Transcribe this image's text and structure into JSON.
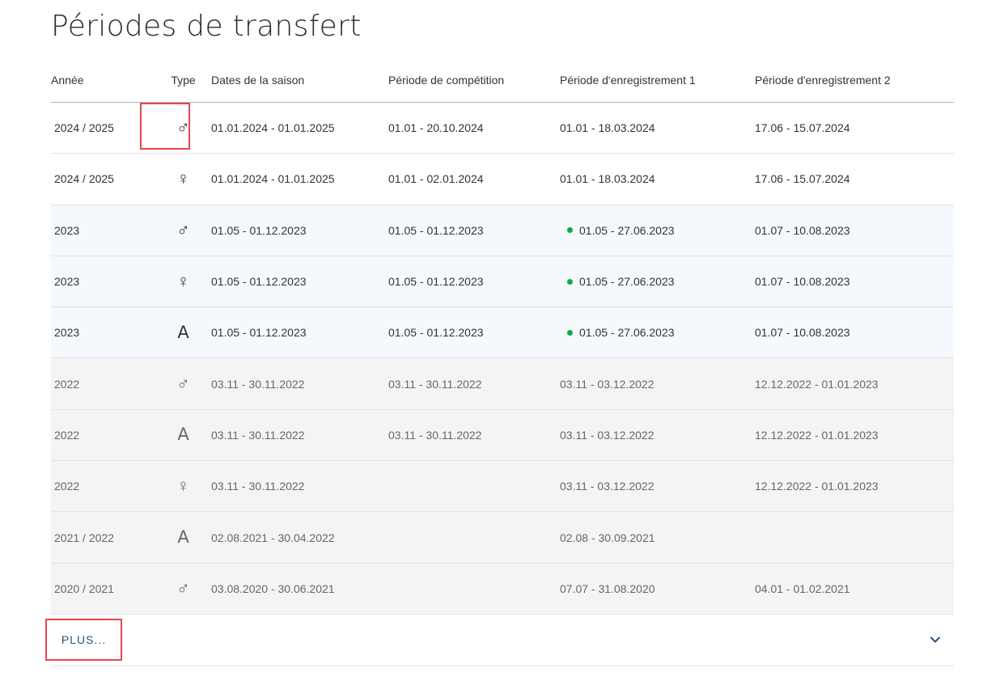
{
  "title": "Périodes de transfert",
  "columns": {
    "year": "Année",
    "type": "Type",
    "season": "Dates de la saison",
    "competition": "Période de compétition",
    "reg1": "Période d'enregistrement 1",
    "reg2": "Période d'enregistrement 2"
  },
  "rows": [
    {
      "year": "2024 / 2025",
      "type": "♂",
      "season": "01.01.2024 - 01.01.2025",
      "competition": "01.01 - 20.10.2024",
      "reg1": "01.01 - 18.03.2024",
      "reg2": "17.06 - 15.07.2024"
    },
    {
      "year": "2024 / 2025",
      "type": "♀",
      "season": "01.01.2024 - 01.01.2025",
      "competition": "01.01 - 02.01.2024",
      "reg1": "01.01 - 18.03.2024",
      "reg2": "17.06 - 15.07.2024"
    },
    {
      "year": "2023",
      "type": "♂",
      "season": "01.05 - 01.12.2023",
      "competition": "01.05 - 01.12.2023",
      "reg1": "01.05 - 27.06.2023",
      "reg2": "01.07 - 10.08.2023"
    },
    {
      "year": "2023",
      "type": "♀",
      "season": "01.05 - 01.12.2023",
      "competition": "01.05 - 01.12.2023",
      "reg1": "01.05 - 27.06.2023",
      "reg2": "01.07 - 10.08.2023"
    },
    {
      "year": "2023",
      "type": "A",
      "season": "01.05 - 01.12.2023",
      "competition": "01.05 - 01.12.2023",
      "reg1": "01.05 - 27.06.2023",
      "reg2": "01.07 - 10.08.2023"
    },
    {
      "year": "2022",
      "type": "♂",
      "season": "03.11 - 30.11.2022",
      "competition": "03.11 - 30.11.2022",
      "reg1": "03.11 - 03.12.2022",
      "reg2": "12.12.2022 - 01.01.2023"
    },
    {
      "year": "2022",
      "type": "A",
      "season": "03.11 - 30.11.2022",
      "competition": "03.11 - 30.11.2022",
      "reg1": "03.11 - 03.12.2022",
      "reg2": "12.12.2022 - 01.01.2023"
    },
    {
      "year": "2022",
      "type": "♀",
      "season": "03.11 - 30.11.2022",
      "competition": "",
      "reg1": "03.11 - 03.12.2022",
      "reg2": "12.12.2022 - 01.01.2023"
    },
    {
      "year": "2021 / 2022",
      "type": "A",
      "season": "02.08.2021 - 30.04.2022",
      "competition": "",
      "reg1": "02.08 - 30.09.2021",
      "reg2": ""
    },
    {
      "year": "2020 / 2021",
      "type": "♂",
      "season": "03.08.2020 - 30.06.2021",
      "competition": "",
      "reg1": "07.07 - 31.08.2020",
      "reg2": "04.01 - 01.02.2021"
    }
  ],
  "more_label": "PLUS...",
  "colors": {
    "active_dot": "#16a34a",
    "accent": "#2c5382",
    "highlight": "#e5484d"
  }
}
